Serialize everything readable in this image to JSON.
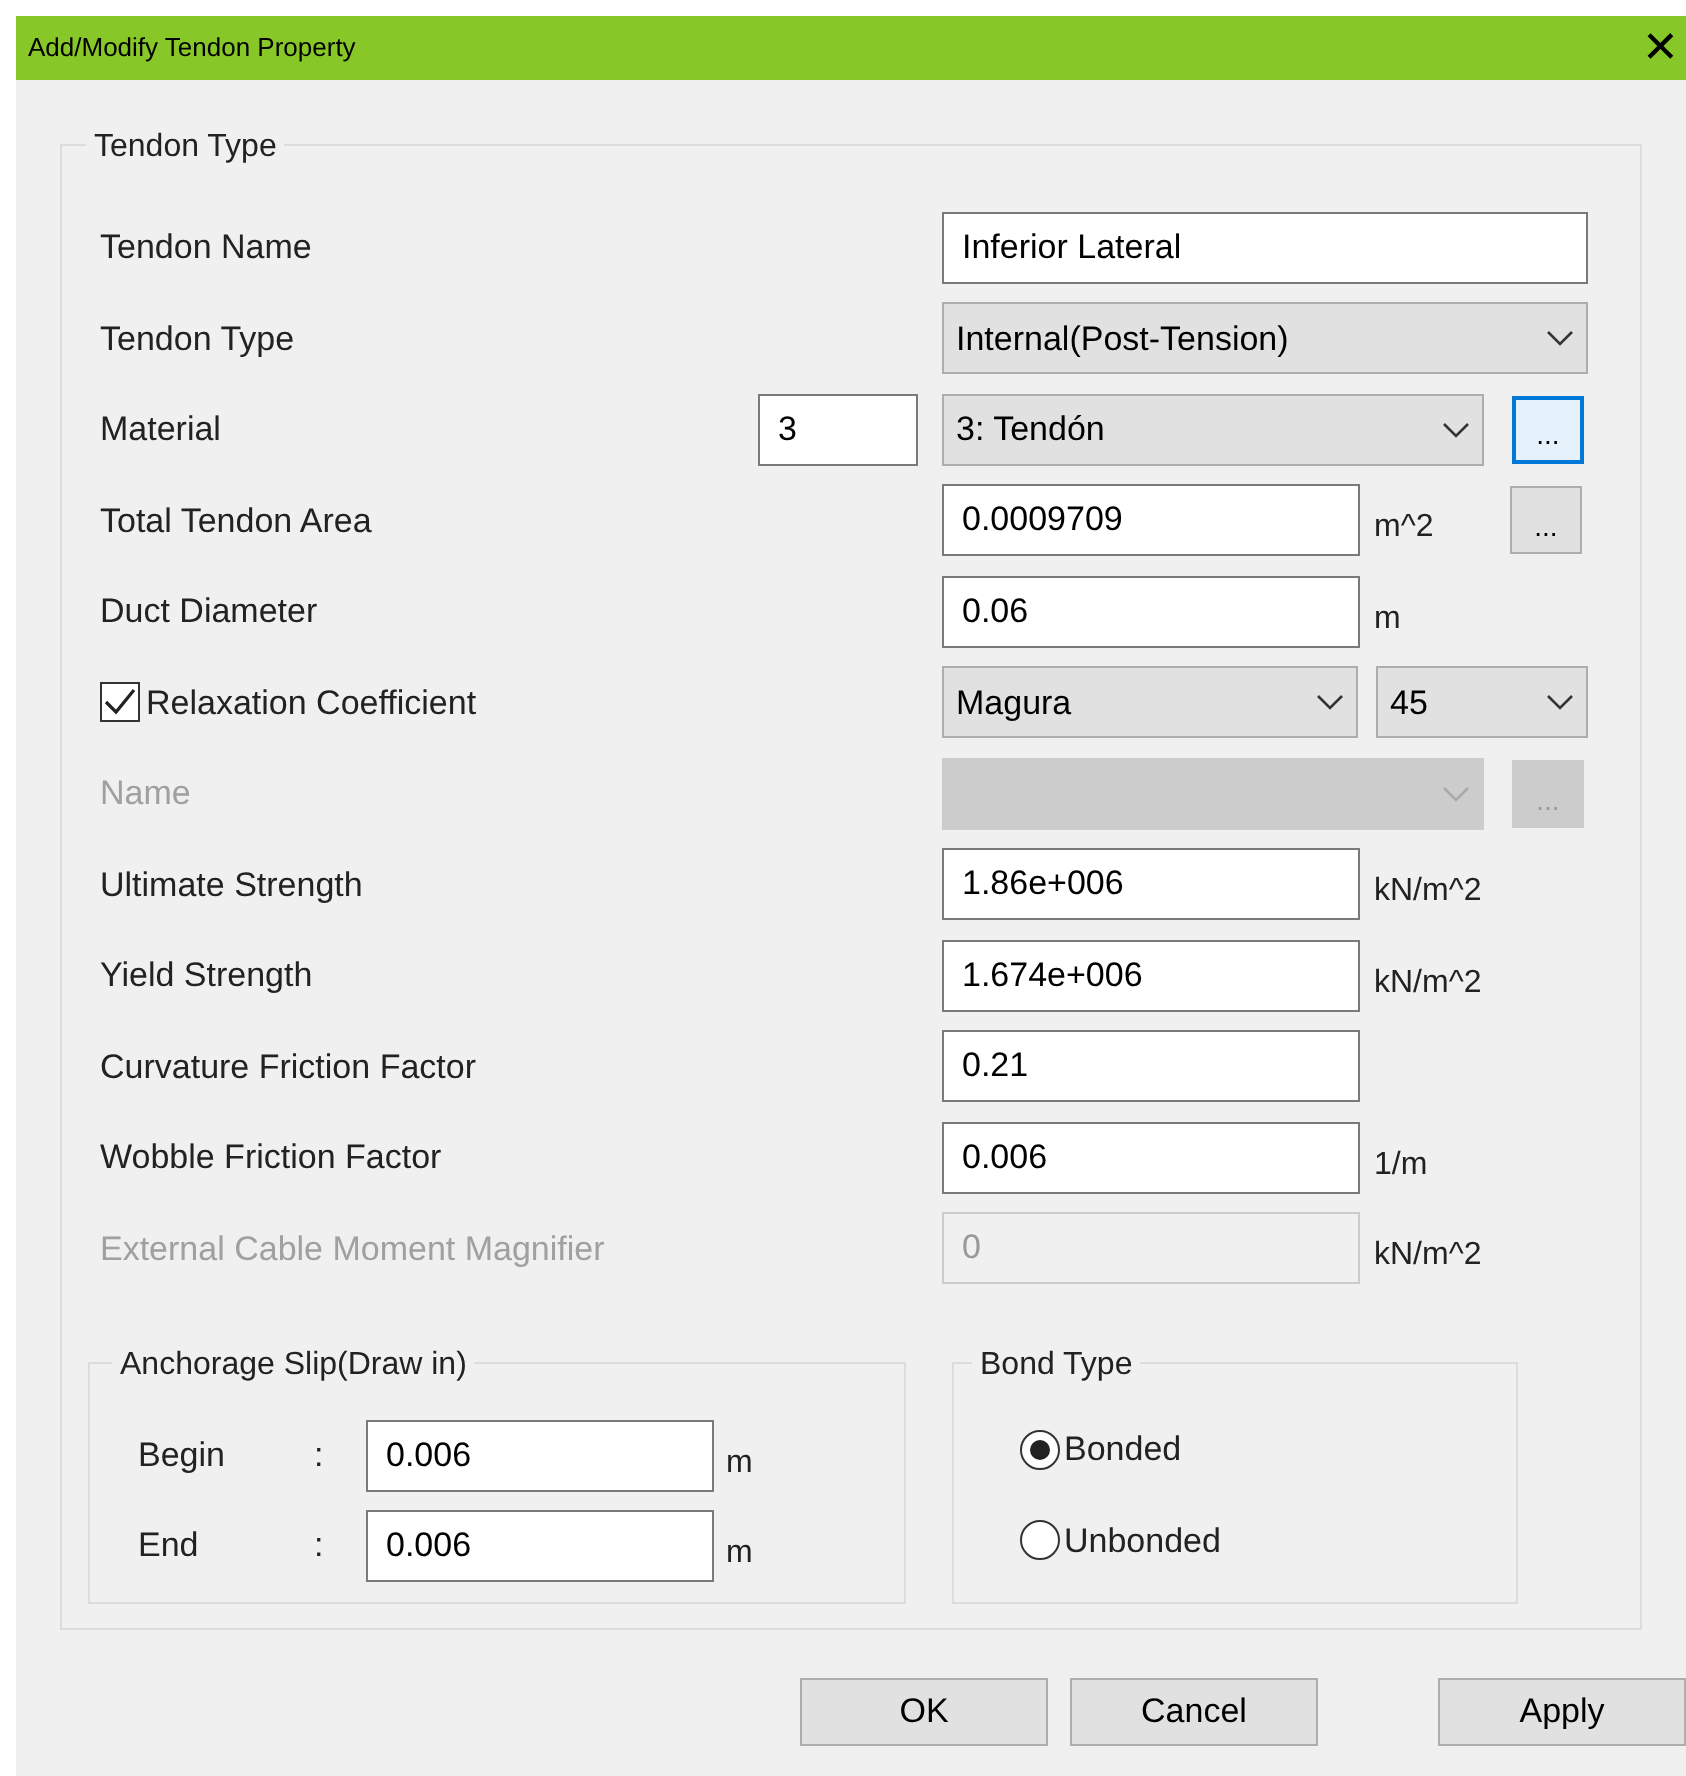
{
  "window": {
    "title": "Add/Modify Tendon Property",
    "close": "✕"
  },
  "group": {
    "title": "Tendon Type"
  },
  "rows": [
    {
      "kind": "text",
      "label": "Tendon Name",
      "value": "Inferior Lateral",
      "wide": true
    },
    {
      "kind": "select",
      "label": "Tendon Type",
      "value": "Internal(Post-Tension)"
    },
    {
      "kind": "material",
      "label": "Material",
      "number": "3",
      "value": "3: Tendón",
      "browse": "...",
      "focused": true
    },
    {
      "kind": "text",
      "label": "Total Tendon Area",
      "value": "0.0009709",
      "unit": "m^2",
      "browse": "..."
    },
    {
      "kind": "text",
      "label": "Duct Diameter",
      "value": "0.06",
      "unit": "m"
    },
    {
      "kind": "check",
      "label": "Relaxation Coefficient",
      "checked": true,
      "values": [
        "Magura",
        "45"
      ]
    },
    {
      "kind": "material",
      "label": "Name",
      "browse": "...",
      "disabled": true
    },
    {
      "kind": "text",
      "label": "Ultimate Strength",
      "value": "1.86e+006",
      "unit": "kN/m^2"
    },
    {
      "kind": "text",
      "label": "Yield Strength",
      "value": "1.674e+006",
      "unit": "kN/m^2"
    },
    {
      "kind": "text",
      "label": "Curvature Friction Factor",
      "value": "0.21"
    },
    {
      "kind": "text",
      "label": "Wobble Friction Factor",
      "value": "0.006",
      "unit": "1/m"
    },
    {
      "kind": "text",
      "label": "External Cable Moment Magnifier",
      "value": "0",
      "unit": "kN/m^2",
      "disabled": true
    }
  ],
  "anchorage": {
    "title": "Anchorage Slip(Draw in)",
    "rows": [
      {
        "label": "Begin",
        "colon": ":",
        "value": "0.006",
        "unit": "m"
      },
      {
        "label": "End",
        "colon": ":",
        "value": "0.006",
        "unit": "m"
      }
    ]
  },
  "bond": {
    "title": "Bond Type",
    "options": [
      {
        "label": "Bonded",
        "selected": true
      },
      {
        "label": "Unbonded",
        "selected": false
      }
    ]
  },
  "buttons": [
    "OK",
    "Cancel",
    "Apply"
  ]
}
